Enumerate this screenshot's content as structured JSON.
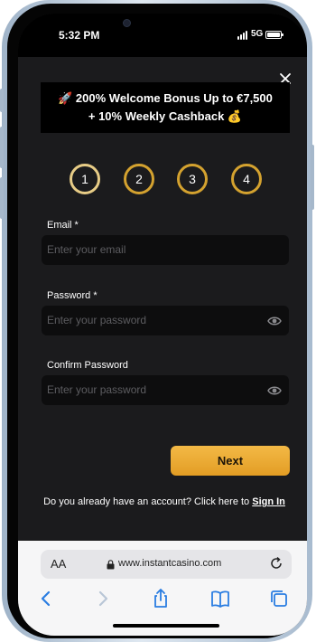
{
  "status_bar": {
    "time": "5:32 PM",
    "network": "5G"
  },
  "promo": {
    "line1": "🚀 200% Welcome Bonus Up to €7,500",
    "line2": "+ 10% Weekly Cashback 💰"
  },
  "steps": [
    "1",
    "2",
    "3",
    "4"
  ],
  "active_step": 1,
  "form": {
    "email_label": "Email *",
    "email_placeholder": "Enter your email",
    "password_label": "Password *",
    "password_placeholder": "Enter your password",
    "confirm_label": "Confirm Password",
    "confirm_placeholder": "Enter your password",
    "next_label": "Next"
  },
  "account_prompt": {
    "text": "Do you already have an account? Click here to ",
    "link": "Sign In"
  },
  "browser": {
    "text_size_label": "AA",
    "url": "www.instantcasino.com"
  },
  "colors": {
    "accent_gold": "#e39d24",
    "step_ring": "#d4a22f",
    "background": "#1b1b1d",
    "input_bg": "#0d0d0e"
  },
  "icons": [
    "close-icon",
    "eye-icon",
    "lock-icon",
    "reload-icon",
    "back-icon",
    "forward-icon",
    "share-icon",
    "bookmarks-icon",
    "tabs-icon"
  ]
}
